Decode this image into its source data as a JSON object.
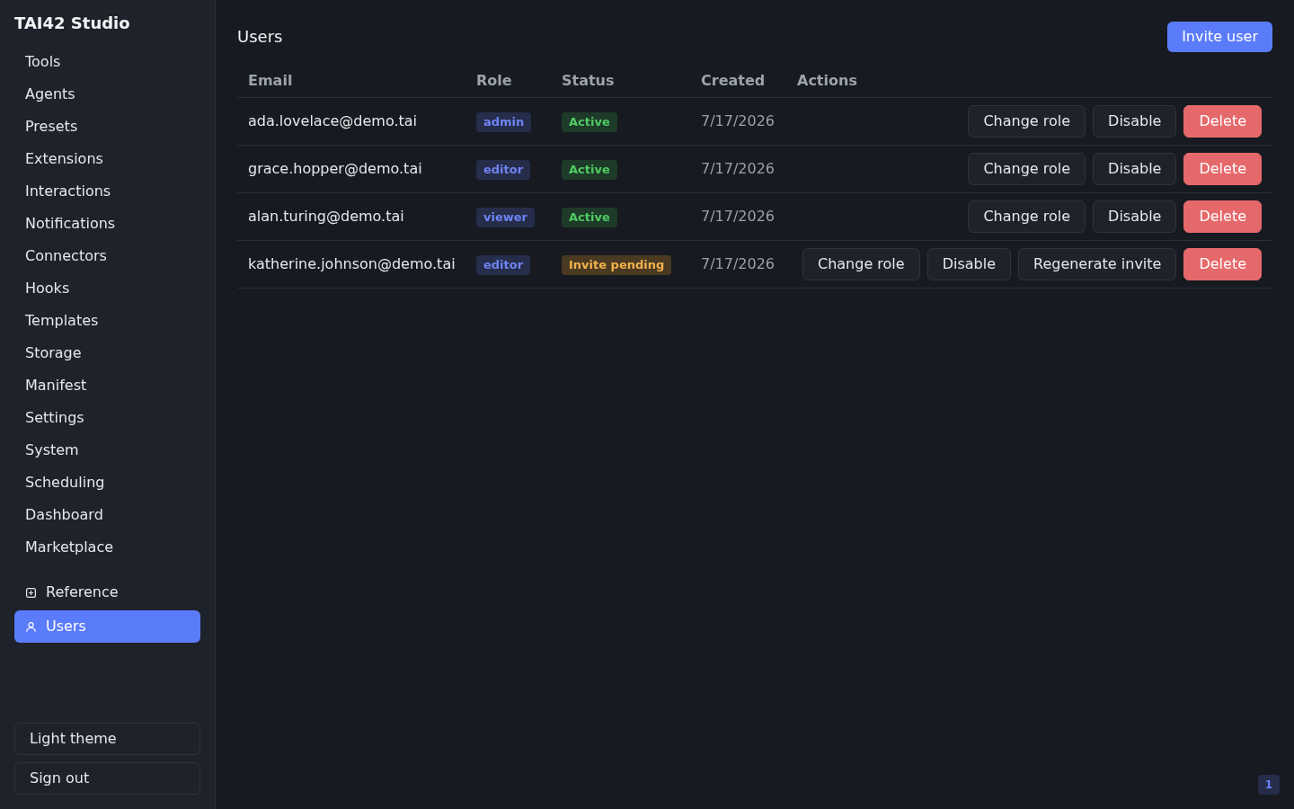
{
  "sidebar": {
    "brand": "TAI42 Studio",
    "items": [
      {
        "label": "Tools",
        "selected": false
      },
      {
        "label": "Agents",
        "selected": false
      },
      {
        "label": "Presets",
        "selected": false
      },
      {
        "label": "Extensions",
        "selected": false
      },
      {
        "label": "Interactions",
        "selected": false
      },
      {
        "label": "Notifications",
        "selected": false
      },
      {
        "label": "Connectors",
        "selected": false
      },
      {
        "label": "Hooks",
        "selected": false
      },
      {
        "label": "Templates",
        "selected": false
      },
      {
        "label": "Storage",
        "selected": false
      },
      {
        "label": "Manifest",
        "selected": false
      },
      {
        "label": "Settings",
        "selected": false
      },
      {
        "label": "System",
        "selected": false
      },
      {
        "label": "Scheduling",
        "selected": false
      },
      {
        "label": "Dashboard",
        "selected": false
      },
      {
        "label": "Marketplace",
        "selected": false
      }
    ],
    "extra_items": [
      {
        "label": "Reference",
        "selected": false
      },
      {
        "label": "Users",
        "selected": true
      }
    ],
    "footer_buttons": [
      "Light theme",
      "Sign out"
    ]
  },
  "header": {
    "title": "Users",
    "button": "Invite user"
  },
  "table": {
    "columns": [
      "Email",
      "Role",
      "Status",
      "Created",
      "Actions"
    ],
    "rows": [
      {
        "email": "ada.lovelace@demo.tai",
        "role": "admin",
        "status": {
          "label": "Active",
          "kind": "active"
        },
        "created": "7/17/2026",
        "actions": [
          {
            "label": "Change role",
            "kind": "default"
          },
          {
            "label": "Disable",
            "kind": "default"
          },
          {
            "label": "Delete",
            "kind": "danger"
          }
        ]
      },
      {
        "email": "grace.hopper@demo.tai",
        "role": "editor",
        "status": {
          "label": "Active",
          "kind": "active"
        },
        "created": "7/17/2026",
        "actions": [
          {
            "label": "Change role",
            "kind": "default"
          },
          {
            "label": "Disable",
            "kind": "default"
          },
          {
            "label": "Delete",
            "kind": "danger"
          }
        ]
      },
      {
        "email": "alan.turing@demo.tai",
        "role": "viewer",
        "status": {
          "label": "Active",
          "kind": "active"
        },
        "created": "7/17/2026",
        "actions": [
          {
            "label": "Change role",
            "kind": "default"
          },
          {
            "label": "Disable",
            "kind": "default"
          },
          {
            "label": "Delete",
            "kind": "danger"
          }
        ]
      },
      {
        "email": "katherine.johnson@demo.tai",
        "role": "editor",
        "status": {
          "label": "Invite pending",
          "kind": "pending"
        },
        "created": "7/17/2026",
        "actions": [
          {
            "label": "Change role",
            "kind": "default"
          },
          {
            "label": "Disable",
            "kind": "default"
          },
          {
            "label": "Regenerate invite",
            "kind": "default"
          },
          {
            "label": "Delete",
            "kind": "danger"
          }
        ]
      }
    ]
  },
  "corner_badge": "1"
}
